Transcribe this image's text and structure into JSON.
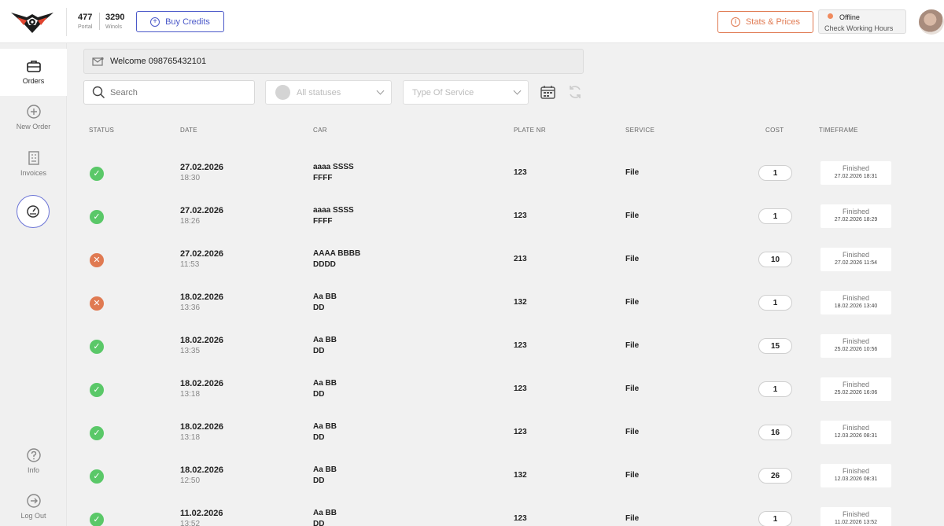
{
  "header": {
    "credits": [
      {
        "value": "477",
        "label": "Portal"
      },
      {
        "value": "3290",
        "label": "Winols"
      }
    ],
    "buy_credits_label": "Buy Credits",
    "stats_prices_label": "Stats & Prices",
    "status_title": "Offline",
    "status_subtitle": "Check Working Hours"
  },
  "sidebar": {
    "orders": "Orders",
    "new_order": "New Order",
    "invoices": "Invoices",
    "info": "Info",
    "logout": "Log Out"
  },
  "welcome": "Welcome 098765432101",
  "filters": {
    "search_placeholder": "Search",
    "status_placeholder": "All statuses",
    "service_placeholder": "Type Of Service"
  },
  "table": {
    "headers": {
      "status": "STATUS",
      "date": "DATE",
      "car": "CAR",
      "plate": "PLATE NR",
      "service": "SERVICE",
      "cost": "COST",
      "timeframe": "TIMEFRAME"
    },
    "rows": [
      {
        "status": "success",
        "date": "27.02.2026",
        "time": "18:30",
        "car_line1": "aaaa SSSS",
        "car_line2": "FFFF",
        "plate": "123",
        "service": "File",
        "cost": "1",
        "timeframe_status": "Finished",
        "timeframe_date": "27.02.2026  18:31"
      },
      {
        "status": "success",
        "date": "27.02.2026",
        "time": "18:26",
        "car_line1": "aaaa SSSS",
        "car_line2": "FFFF",
        "plate": "123",
        "service": "File",
        "cost": "1",
        "timeframe_status": "Finished",
        "timeframe_date": "27.02.2026  18:29"
      },
      {
        "status": "error",
        "date": "27.02.2026",
        "time": "11:53",
        "car_line1": "AAAA BBBB",
        "car_line2": "DDDD",
        "plate": "213",
        "service": "File",
        "cost": "10",
        "timeframe_status": "Finished",
        "timeframe_date": "27.02.2026  11:54"
      },
      {
        "status": "error",
        "date": "18.02.2026",
        "time": "13:36",
        "car_line1": "Aa BB",
        "car_line2": "DD",
        "plate": "132",
        "service": "File",
        "cost": "1",
        "timeframe_status": "Finished",
        "timeframe_date": "18.02.2026  13:40"
      },
      {
        "status": "success",
        "date": "18.02.2026",
        "time": "13:35",
        "car_line1": "Aa BB",
        "car_line2": "DD",
        "plate": "123",
        "service": "File",
        "cost": "15",
        "timeframe_status": "Finished",
        "timeframe_date": "25.02.2026  10:56"
      },
      {
        "status": "success",
        "date": "18.02.2026",
        "time": "13:18",
        "car_line1": "Aa BB",
        "car_line2": "DD",
        "plate": "123",
        "service": "File",
        "cost": "1",
        "timeframe_status": "Finished",
        "timeframe_date": "25.02.2026  16:06"
      },
      {
        "status": "success",
        "date": "18.02.2026",
        "time": "13:18",
        "car_line1": "Aa BB",
        "car_line2": "DD",
        "plate": "123",
        "service": "File",
        "cost": "16",
        "timeframe_status": "Finished",
        "timeframe_date": "12.03.2026  08:31"
      },
      {
        "status": "success",
        "date": "18.02.2026",
        "time": "12:50",
        "car_line1": "Aa BB",
        "car_line2": "DD",
        "plate": "132",
        "service": "File",
        "cost": "26",
        "timeframe_status": "Finished",
        "timeframe_date": "12.03.2026  08:31"
      },
      {
        "status": "success",
        "date": "11.02.2026",
        "time": "13:52",
        "car_line1": "Aa BB",
        "car_line2": "DD",
        "plate": "123",
        "service": "File",
        "cost": "1",
        "timeframe_status": "Finished",
        "timeframe_date": "11.02.2026  13:52"
      }
    ]
  },
  "colors": {
    "accent": "#4b59c9",
    "warning": "#e07a52",
    "success": "#5ac868",
    "offline_dot": "#f08a5d"
  }
}
